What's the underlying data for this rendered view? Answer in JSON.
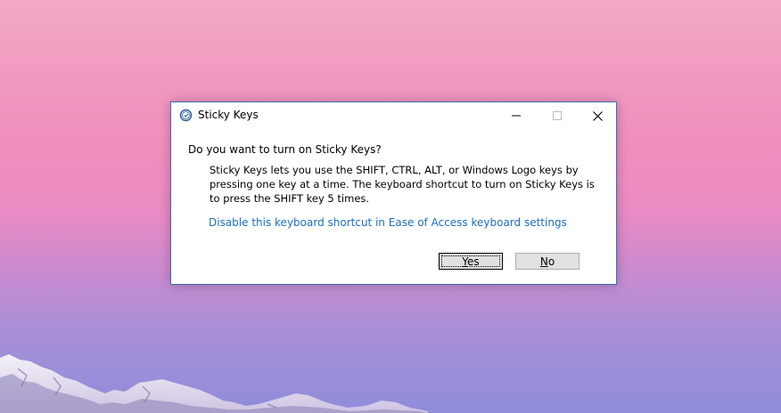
{
  "dialog": {
    "title": "Sticky Keys",
    "icon": "ease-of-access-icon",
    "controls": {
      "minimize_icon": "minimize-icon",
      "maximize_icon": "maximize-icon",
      "close_icon": "close-icon"
    },
    "question": "Do you want to turn on Sticky Keys?",
    "description": "Sticky Keys lets you use the SHIFT, CTRL, ALT, or Windows Logo keys by pressing one key at a time. The keyboard shortcut to turn on Sticky Keys is to press the SHIFT key 5 times.",
    "link": "Disable this keyboard shortcut in Ease of Access keyboard settings",
    "buttons": {
      "yes": "Yes",
      "no": "No"
    }
  },
  "colors": {
    "link": "#1a6fc2",
    "dialog_border": "#3c6cb8",
    "button_face": "#e1e1e1"
  }
}
